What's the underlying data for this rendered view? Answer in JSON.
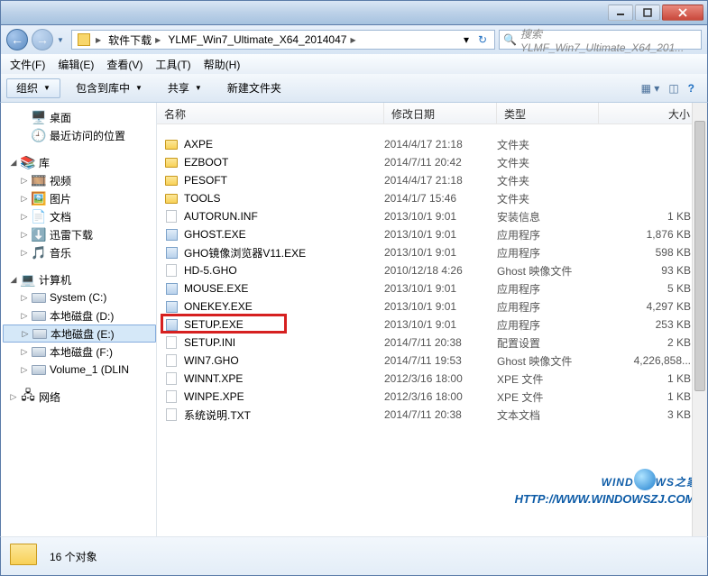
{
  "titlebar": {},
  "nav": {
    "breadcrumbs": [
      {
        "label": "软件下载"
      },
      {
        "label": "YLMF_Win7_Ultimate_X64_2014047"
      }
    ],
    "search_placeholder": "搜索 YLMF_Win7_Ultimate_X64_201..."
  },
  "menubar": [
    "文件(F)",
    "编辑(E)",
    "查看(V)",
    "工具(T)",
    "帮助(H)"
  ],
  "toolbar": {
    "organize": "组织",
    "include": "包含到库中",
    "share": "共享",
    "newfolder": "新建文件夹"
  },
  "tree": {
    "desktop": "桌面",
    "recent": "最近访问的位置",
    "libraries": "库",
    "videos": "视频",
    "pictures": "图片",
    "documents": "文档",
    "thunder": "迅雷下载",
    "music": "音乐",
    "computer": "计算机",
    "drive_c": "System (C:)",
    "drive_d": "本地磁盘 (D:)",
    "drive_e": "本地磁盘 (E:)",
    "drive_f": "本地磁盘 (F:)",
    "drive_vol": "Volume_1 (DLIN",
    "network": "网络"
  },
  "columns": {
    "name": "名称",
    "date": "修改日期",
    "type": "类型",
    "size": "大小"
  },
  "files": [
    {
      "name": "AXPE",
      "date": "2014/4/17 21:18",
      "type": "文件夹",
      "size": "",
      "icon": "folder"
    },
    {
      "name": "EZBOOT",
      "date": "2014/7/11 20:42",
      "type": "文件夹",
      "size": "",
      "icon": "folder"
    },
    {
      "name": "PESOFT",
      "date": "2014/4/17 21:18",
      "type": "文件夹",
      "size": "",
      "icon": "folder"
    },
    {
      "name": "TOOLS",
      "date": "2014/1/7 15:46",
      "type": "文件夹",
      "size": "",
      "icon": "folder"
    },
    {
      "name": "AUTORUN.INF",
      "date": "2013/10/1 9:01",
      "type": "安装信息",
      "size": "1 KB",
      "icon": "file"
    },
    {
      "name": "GHOST.EXE",
      "date": "2013/10/1 9:01",
      "type": "应用程序",
      "size": "1,876 KB",
      "icon": "exe"
    },
    {
      "name": "GHO镜像浏览器V11.EXE",
      "date": "2013/10/1 9:01",
      "type": "应用程序",
      "size": "598 KB",
      "icon": "exe"
    },
    {
      "name": "HD-5.GHO",
      "date": "2010/12/18 4:26",
      "type": "Ghost 映像文件",
      "size": "93 KB",
      "icon": "file"
    },
    {
      "name": "MOUSE.EXE",
      "date": "2013/10/1 9:01",
      "type": "应用程序",
      "size": "5 KB",
      "icon": "exe"
    },
    {
      "name": "ONEKEY.EXE",
      "date": "2013/10/1 9:01",
      "type": "应用程序",
      "size": "4,297 KB",
      "icon": "exe"
    },
    {
      "name": "SETUP.EXE",
      "date": "2013/10/1 9:01",
      "type": "应用程序",
      "size": "253 KB",
      "icon": "exe",
      "highlighted": true
    },
    {
      "name": "SETUP.INI",
      "date": "2014/7/11 20:38",
      "type": "配置设置",
      "size": "2 KB",
      "icon": "file"
    },
    {
      "name": "WIN7.GHO",
      "date": "2014/7/11 19:53",
      "type": "Ghost 映像文件",
      "size": "4,226,858...",
      "icon": "file"
    },
    {
      "name": "WINNT.XPE",
      "date": "2012/3/16 18:00",
      "type": "XPE 文件",
      "size": "1 KB",
      "icon": "file"
    },
    {
      "name": "WINPE.XPE",
      "date": "2012/3/16 18:00",
      "type": "XPE 文件",
      "size": "1 KB",
      "icon": "file"
    },
    {
      "name": "系统说明.TXT",
      "date": "2014/7/11 20:38",
      "type": "文本文档",
      "size": "3 KB",
      "icon": "file"
    }
  ],
  "status": {
    "count_text": "16 个对象"
  },
  "watermark": {
    "line1_a": "WIND",
    "line1_b": "WS",
    "line1_c": "之家",
    "line2": "HTTP://WWW.WINDOWSZJ.COM/"
  }
}
